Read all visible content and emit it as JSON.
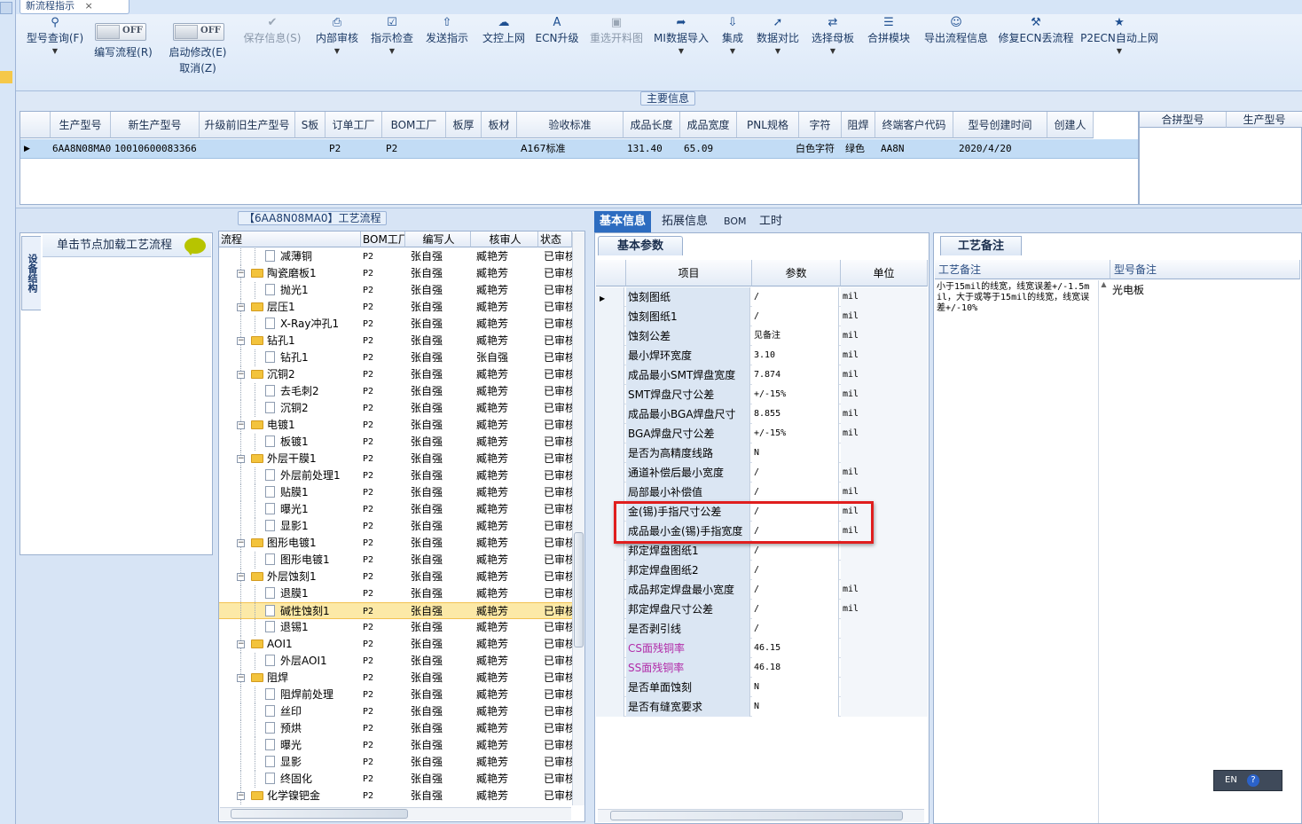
{
  "window": {
    "doc_tab": "新流程指示"
  },
  "ribbon": {
    "buttons": [
      {
        "label": "型号查询(F)",
        "icon": "search-icon"
      },
      {
        "label": "编写流程(R)",
        "toggle": "OFF"
      },
      {
        "label": "启动修改(E)",
        "sublabel": "取消(Z)",
        "toggle": "OFF"
      },
      {
        "label": "保存信息(S)",
        "icon": "check-icon",
        "disabled": true
      },
      {
        "label": "内部审核",
        "icon": "printer-icon"
      },
      {
        "label": "指示检查",
        "icon": "checkbox-icon"
      },
      {
        "label": "发送指示",
        "icon": "upload-icon"
      },
      {
        "label": "文控上网",
        "icon": "cloud-icon"
      },
      {
        "label": "ECN升级",
        "icon": "letter-a-icon"
      },
      {
        "label": "重选开料图",
        "icon": "image-icon",
        "disabled": true
      },
      {
        "label": "MI数据导入",
        "icon": "import-icon"
      },
      {
        "label": "集成",
        "icon": "download-icon"
      },
      {
        "label": "数据对比",
        "icon": "compare-icon"
      },
      {
        "label": "选择母板",
        "icon": "shuffle-icon"
      },
      {
        "label": "合拼模块",
        "icon": "list-icon"
      },
      {
        "label": "导出流程信息",
        "icon": "smile-icon"
      },
      {
        "label": "修复ECN丢流程",
        "icon": "wrench-icon"
      },
      {
        "label": "P2ECN自动上网",
        "icon": "star-icon"
      }
    ]
  },
  "main_info": {
    "title": "主要信息",
    "columns": [
      "生产型号",
      "新生产型号",
      "升级前旧生产型号",
      "S板",
      "订单工厂",
      "BOM工厂",
      "板厚",
      "板材",
      "验收标准",
      "成品长度",
      "成品宽度",
      "PNL规格",
      "字符",
      "阻焊",
      "终端客户代码",
      "型号创建时间",
      "创建人"
    ],
    "row": [
      "6AA8N08MA0",
      "10010600083366",
      "",
      "",
      "P2",
      "P2",
      "",
      "",
      "A167标准",
      "131.40",
      "65.09",
      "",
      "白色字符",
      "绿色",
      "AA8N",
      "2020/4/20",
      ""
    ],
    "merge_columns": [
      "合拼型号",
      "生产型号"
    ]
  },
  "left_panel": {
    "vertical_tab": "设备结构",
    "hint": "单击节点加载工艺流程"
  },
  "process_flow": {
    "title": "【6AA8N08MA0】工艺流程",
    "columns": [
      "流程",
      "BOM工厂",
      "编写人",
      "核审人",
      "状态"
    ],
    "rows": [
      {
        "name": "减薄铜",
        "level": 2,
        "bom": "P2",
        "writer": "张自强",
        "reviewer": "臧艳芳",
        "status": "已审核"
      },
      {
        "name": "陶瓷磨板1",
        "level": 1,
        "bom": "P2",
        "writer": "张自强",
        "reviewer": "臧艳芳",
        "status": "已审核"
      },
      {
        "name": "抛光1",
        "level": 2,
        "bom": "P2",
        "writer": "张自强",
        "reviewer": "臧艳芳",
        "status": "已审核"
      },
      {
        "name": "层压1",
        "level": 1,
        "bom": "P2",
        "writer": "张自强",
        "reviewer": "臧艳芳",
        "status": "已审核"
      },
      {
        "name": "X-Ray冲孔1",
        "level": 2,
        "bom": "P2",
        "writer": "张自强",
        "reviewer": "臧艳芳",
        "status": "已审核"
      },
      {
        "name": "钻孔1",
        "level": 1,
        "bom": "P2",
        "writer": "张自强",
        "reviewer": "臧艳芳",
        "status": "已审核"
      },
      {
        "name": "钻孔1",
        "level": 2,
        "bom": "P2",
        "writer": "张自强",
        "reviewer": "张自强",
        "status": "已审核"
      },
      {
        "name": "沉铜2",
        "level": 1,
        "bom": "P2",
        "writer": "张自强",
        "reviewer": "臧艳芳",
        "status": "已审核"
      },
      {
        "name": "去毛刺2",
        "level": 2,
        "bom": "P2",
        "writer": "张自强",
        "reviewer": "臧艳芳",
        "status": "已审核"
      },
      {
        "name": "沉铜2",
        "level": 2,
        "bom": "P2",
        "writer": "张自强",
        "reviewer": "臧艳芳",
        "status": "已审核"
      },
      {
        "name": "电镀1",
        "level": 1,
        "bom": "P2",
        "writer": "张自强",
        "reviewer": "臧艳芳",
        "status": "已审核"
      },
      {
        "name": "板镀1",
        "level": 2,
        "bom": "P2",
        "writer": "张自强",
        "reviewer": "臧艳芳",
        "status": "已审核"
      },
      {
        "name": "外层干膜1",
        "level": 1,
        "bom": "P2",
        "writer": "张自强",
        "reviewer": "臧艳芳",
        "status": "已审核"
      },
      {
        "name": "外层前处理1",
        "level": 2,
        "bom": "P2",
        "writer": "张自强",
        "reviewer": "臧艳芳",
        "status": "已审核"
      },
      {
        "name": "贴膜1",
        "level": 2,
        "bom": "P2",
        "writer": "张自强",
        "reviewer": "臧艳芳",
        "status": "已审核"
      },
      {
        "name": "曝光1",
        "level": 2,
        "bom": "P2",
        "writer": "张自强",
        "reviewer": "臧艳芳",
        "status": "已审核"
      },
      {
        "name": "显影1",
        "level": 2,
        "bom": "P2",
        "writer": "张自强",
        "reviewer": "臧艳芳",
        "status": "已审核"
      },
      {
        "name": "图形电镀1",
        "level": 1,
        "bom": "P2",
        "writer": "张自强",
        "reviewer": "臧艳芳",
        "status": "已审核"
      },
      {
        "name": "图形电镀1",
        "level": 2,
        "bom": "P2",
        "writer": "张自强",
        "reviewer": "臧艳芳",
        "status": "已审核"
      },
      {
        "name": "外层蚀刻1",
        "level": 1,
        "bom": "P2",
        "writer": "张自强",
        "reviewer": "臧艳芳",
        "status": "已审核"
      },
      {
        "name": "退膜1",
        "level": 2,
        "bom": "P2",
        "writer": "张自强",
        "reviewer": "臧艳芳",
        "status": "已审核"
      },
      {
        "name": "碱性蚀刻1",
        "level": 2,
        "bom": "P2",
        "writer": "张自强",
        "reviewer": "臧艳芳",
        "status": "已审核",
        "selected": true
      },
      {
        "name": "退锡1",
        "level": 2,
        "bom": "P2",
        "writer": "张自强",
        "reviewer": "臧艳芳",
        "status": "已审核"
      },
      {
        "name": "AOI1",
        "level": 1,
        "bom": "P2",
        "writer": "张自强",
        "reviewer": "臧艳芳",
        "status": "已审核"
      },
      {
        "name": "外层AOI1",
        "level": 2,
        "bom": "P2",
        "writer": "张自强",
        "reviewer": "臧艳芳",
        "status": "已审核"
      },
      {
        "name": "阻焊",
        "level": 1,
        "bom": "P2",
        "writer": "张自强",
        "reviewer": "臧艳芳",
        "status": "已审核"
      },
      {
        "name": "阻焊前处理",
        "level": 2,
        "bom": "P2",
        "writer": "张自强",
        "reviewer": "臧艳芳",
        "status": "已审核"
      },
      {
        "name": "丝印",
        "level": 2,
        "bom": "P2",
        "writer": "张自强",
        "reviewer": "臧艳芳",
        "status": "已审核"
      },
      {
        "name": "预烘",
        "level": 2,
        "bom": "P2",
        "writer": "张自强",
        "reviewer": "臧艳芳",
        "status": "已审核"
      },
      {
        "name": "曝光",
        "level": 2,
        "bom": "P2",
        "writer": "张自强",
        "reviewer": "臧艳芳",
        "status": "已审核"
      },
      {
        "name": "显影",
        "level": 2,
        "bom": "P2",
        "writer": "张自强",
        "reviewer": "臧艳芳",
        "status": "已审核"
      },
      {
        "name": "终固化",
        "level": 2,
        "bom": "P2",
        "writer": "张自强",
        "reviewer": "臧艳芳",
        "status": "已审核"
      },
      {
        "name": "化学镍钯金",
        "level": 1,
        "bom": "P2",
        "writer": "张自强",
        "reviewer": "臧艳芳",
        "status": "已审核"
      }
    ]
  },
  "info_tabs": [
    "基本信息",
    "拓展信息",
    "BOM",
    "工时"
  ],
  "basic_params": {
    "title": "基本参数",
    "columns": [
      "项目",
      "参数",
      "单位"
    ],
    "rows": [
      {
        "name": "蚀刻图纸",
        "value": "/",
        "unit": "mil"
      },
      {
        "name": "蚀刻图纸1",
        "value": "/",
        "unit": "mil"
      },
      {
        "name": "蚀刻公差",
        "value": "见备注",
        "unit": "mil"
      },
      {
        "name": "最小焊环宽度",
        "value": "3.10",
        "unit": "mil"
      },
      {
        "name": "成品最小SMT焊盘宽度",
        "value": "7.874",
        "unit": "mil"
      },
      {
        "name": "SMT焊盘尺寸公差",
        "value": "+/-15%",
        "unit": "mil"
      },
      {
        "name": "成品最小BGA焊盘尺寸",
        "value": "8.855",
        "unit": "mil"
      },
      {
        "name": "BGA焊盘尺寸公差",
        "value": "+/-15%",
        "unit": "mil"
      },
      {
        "name": "是否为高精度线路",
        "value": "N",
        "unit": ""
      },
      {
        "name": "通道补偿后最小宽度",
        "value": "/",
        "unit": "mil"
      },
      {
        "name": "局部最小补偿值",
        "value": "/",
        "unit": "mil"
      },
      {
        "name": "金(锡)手指尺寸公差",
        "value": "/",
        "unit": "mil"
      },
      {
        "name": "成品最小金(锡)手指宽度",
        "value": "/",
        "unit": "mil"
      },
      {
        "name": "邦定焊盘图纸1",
        "value": "/",
        "unit": ""
      },
      {
        "name": "邦定焊盘图纸2",
        "value": "/",
        "unit": ""
      },
      {
        "name": "成品邦定焊盘最小宽度",
        "value": "/",
        "unit": "mil"
      },
      {
        "name": "邦定焊盘尺寸公差",
        "value": "/",
        "unit": "mil"
      },
      {
        "name": "是否剥引线",
        "value": "/",
        "unit": ""
      },
      {
        "name": "CS面残铜率",
        "value": "46.15",
        "unit": "",
        "purple": true
      },
      {
        "name": "SS面残铜率",
        "value": "46.18",
        "unit": "",
        "purple": true
      },
      {
        "name": "是否单面蚀刻",
        "value": "N",
        "unit": ""
      },
      {
        "name": "是否有缝宽要求",
        "value": "N",
        "unit": ""
      }
    ]
  },
  "process_notes": {
    "title": "工艺备注",
    "columns": [
      "工艺备注",
      "型号备注"
    ],
    "process_note": "小于15mil的线宽，线宽误差+/-1.5mil，大于或等于15mil的线宽，线宽误差+/-10%",
    "model_note": "光电板"
  },
  "ime": {
    "lang": "EN"
  }
}
